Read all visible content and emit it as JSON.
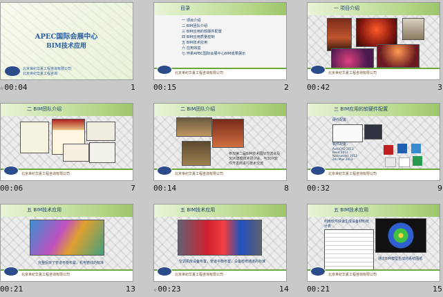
{
  "slides": [
    {
      "time": "00:04",
      "num": "1",
      "star": true,
      "title_line1": "APEC国际会展中心",
      "title_line2": "BIM技术应用",
      "sub1": "北京世纪华夏工程咨询有限公司",
      "sub2": "北京世纪华夏工程咨询"
    },
    {
      "time": "00:15",
      "num": "2",
      "star": false,
      "header": "目录",
      "toc": [
        "一  项目介绍",
        "二  BIM团队介绍",
        "三  BIM应用的软硬件配置",
        "四  BIM应用质量控制",
        "五  BIM技术应用",
        "六  应用效益",
        "七  怀柔APEC国际会展中心BIM成果展示"
      ]
    },
    {
      "time": "00:42",
      "num": "3",
      "star": false,
      "header": "一   项目介绍"
    },
    {
      "time": "00:06",
      "num": "7",
      "star": false,
      "header": "二  BIM团队介绍"
    },
    {
      "time": "00:14",
      "num": "8",
      "star": false,
      "header": "二  BIM团队介绍",
      "caption": "参加第二届BIM技术国际交流会及3DX建模技术研讨会，与3DX软件开发商进行技术交流"
    },
    {
      "time": "00:32",
      "num": "9",
      "star": false,
      "header": "三  BIM应用的软硬件配置",
      "hw_title": "硬件配置：",
      "sw_title": "软件配置：",
      "sw_list": [
        "AutoCAD 2013",
        "Revit 2013",
        "Navisworks 2013",
        "3ds Max 2013",
        "MagiCAD",
        "Tekla",
        "Lumion"
      ]
    },
    {
      "time": "00:21",
      "num": "13",
      "star": false,
      "header": "五   BIM技术应用",
      "caption": "完整反映了管道平衡布置，机电管线的标准"
    },
    {
      "time": "00:23",
      "num": "14",
      "star": true,
      "header": "五   BIM技术应用",
      "caption": "空调机房设备布置，管道平衡布置，设备检修通道的标准"
    },
    {
      "time": "00:21",
      "num": "15",
      "star": false,
      "header": "五   BIM技术应用",
      "caption1": "利用软件快速生成设备材料统计表",
      "caption2": "通过BIM模型生成的系统图纸"
    }
  ],
  "footer_text": "北京世纪华夏工程咨询有限公司",
  "footer_sub": "世纪华夏工程咨询"
}
